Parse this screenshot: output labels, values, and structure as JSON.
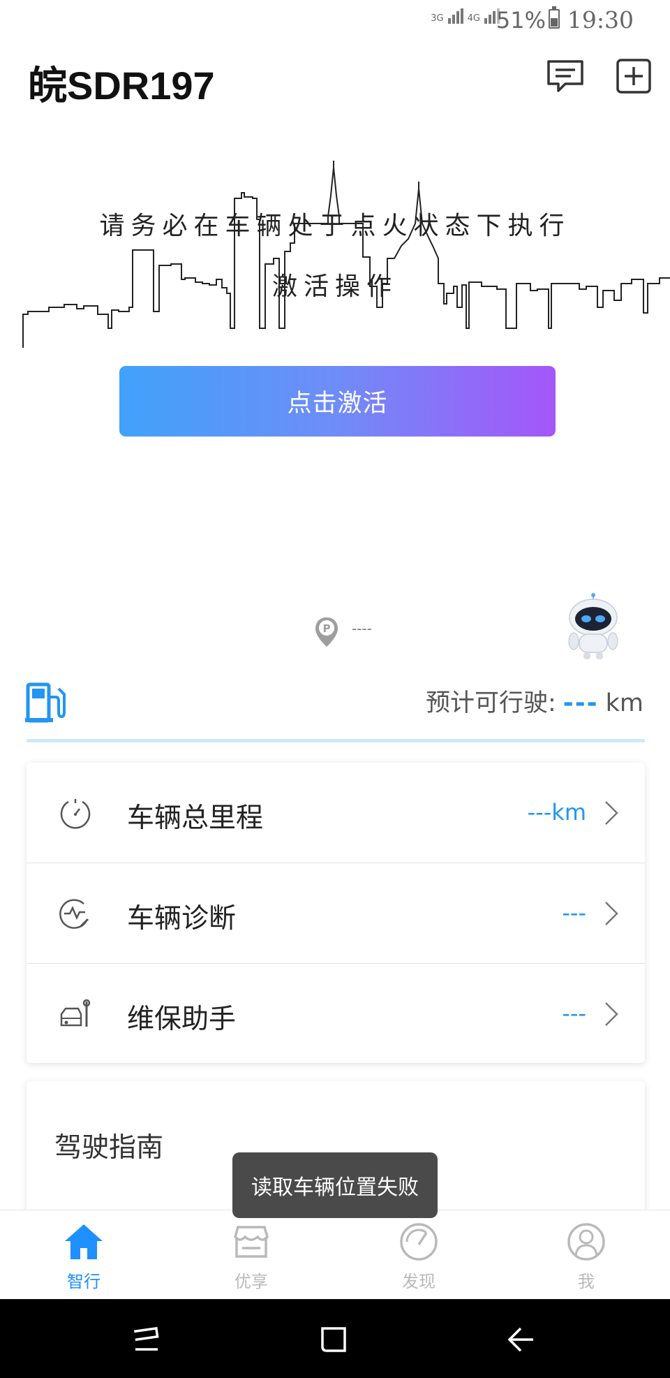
{
  "status_bar": {
    "network_1": "3G",
    "network_2": "4G",
    "battery": "51%",
    "time": "19:30"
  },
  "header": {
    "title": "皖SDR197",
    "icons": [
      "message-icon",
      "add-icon"
    ]
  },
  "hero": {
    "instruction_line1": "请务必在车辆处于点火状态下执行",
    "instruction_line2": "激活操作",
    "activate_button": "点击激活"
  },
  "location": {
    "value": "----"
  },
  "fuel": {
    "range_label": "预计可行驶:",
    "range_value": "---",
    "range_unit": "km"
  },
  "vehicle_rows": [
    {
      "label": "车辆总里程",
      "value": "---km",
      "icon": "odometer-icon"
    },
    {
      "label": "车辆诊断",
      "value": "---",
      "icon": "diagnosis-icon"
    },
    {
      "label": "维保助手",
      "value": "---",
      "icon": "maintenance-icon"
    }
  ],
  "guide": {
    "title": "驾驶指南"
  },
  "toast": {
    "message": "读取车辆位置失败"
  },
  "bottom_nav": [
    {
      "label": "智行",
      "icon": "home-icon",
      "active": true
    },
    {
      "label": "优享",
      "icon": "store-icon",
      "active": false
    },
    {
      "label": "发现",
      "icon": "discover-icon",
      "active": false
    },
    {
      "label": "我",
      "icon": "profile-icon",
      "active": false
    }
  ],
  "colors": {
    "accent": "#2196f3",
    "button_gradient_start": "#41a2fb",
    "button_gradient_end": "#a556f9",
    "nav_active": "#1e90ff",
    "nav_inactive": "#b9b9b9"
  }
}
